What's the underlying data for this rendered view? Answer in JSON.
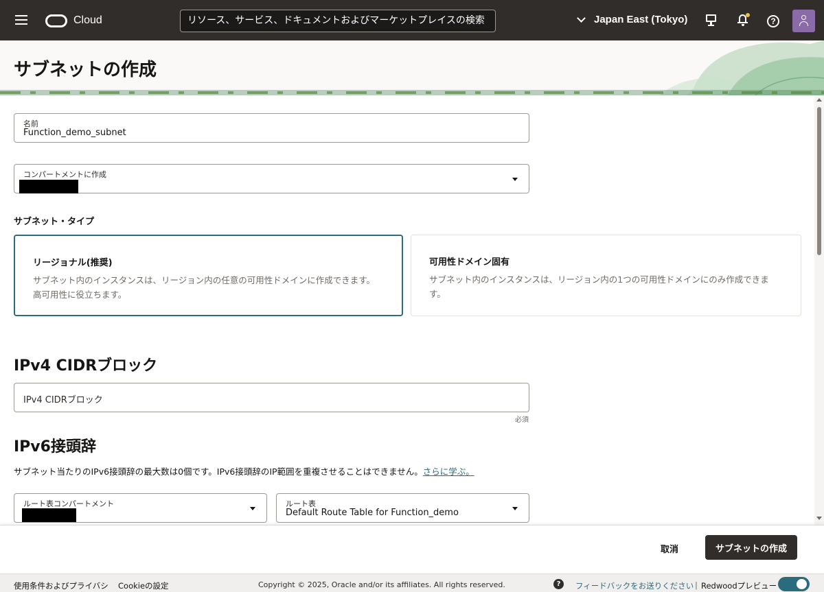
{
  "header": {
    "logo_text": "Cloud",
    "search_placeholder": "リソース、サービス、ドキュメントおよびマーケットプレイスの検索",
    "region": "Japan East (Tokyo)"
  },
  "page": {
    "title": "サブネットの作成"
  },
  "form": {
    "name": {
      "label": "名前",
      "value": "Function_demo_subnet"
    },
    "compartment": {
      "label": "コンパートメントに作成"
    },
    "subnet_type": {
      "label": "サブネット・タイプ",
      "options": [
        {
          "title": "リージョナル(推奨)",
          "desc": "サブネット内のインスタンスは、リージョン内の任意の可用性ドメインに作成できます。高可用性に役立ちます。",
          "selected": true
        },
        {
          "title": "可用性ドメイン固有",
          "desc": "サブネット内のインスタンスは、リージョン内の1つの可用性ドメインにのみ作成できます。",
          "selected": false
        }
      ]
    },
    "ipv4": {
      "heading": "IPv4 CIDRブロック",
      "placeholder": "IPv4 CIDRブロック",
      "required": "必須"
    },
    "ipv6": {
      "heading": "IPv6接頭辞",
      "info": "サブネット当たりのIPv6接頭辞の最大数は0個です。IPv6接頭辞のIP範囲を重複させることはできません。",
      "learn_more": "さらに学ぶ。"
    },
    "route_compartment": {
      "label": "ルート表コンパートメント"
    },
    "route_table": {
      "label": "ルート表",
      "value": "Default Route Table for Function_demo"
    }
  },
  "actions": {
    "cancel": "取消",
    "create": "サブネットの作成"
  },
  "footer": {
    "terms": "使用条件およびプライバシ",
    "cookie": "Cookieの設定",
    "copyright": "Copyright © 2025, Oracle and/or its affiliates. All rights reserved.",
    "feedback": "フィードバックをお送りください",
    "separator": "|",
    "redwood": "Redwoodプレビュー"
  },
  "colors": {
    "header_bg": "#312d2a",
    "accent": "#2b6b7e",
    "primary_button": "#312d2a"
  }
}
